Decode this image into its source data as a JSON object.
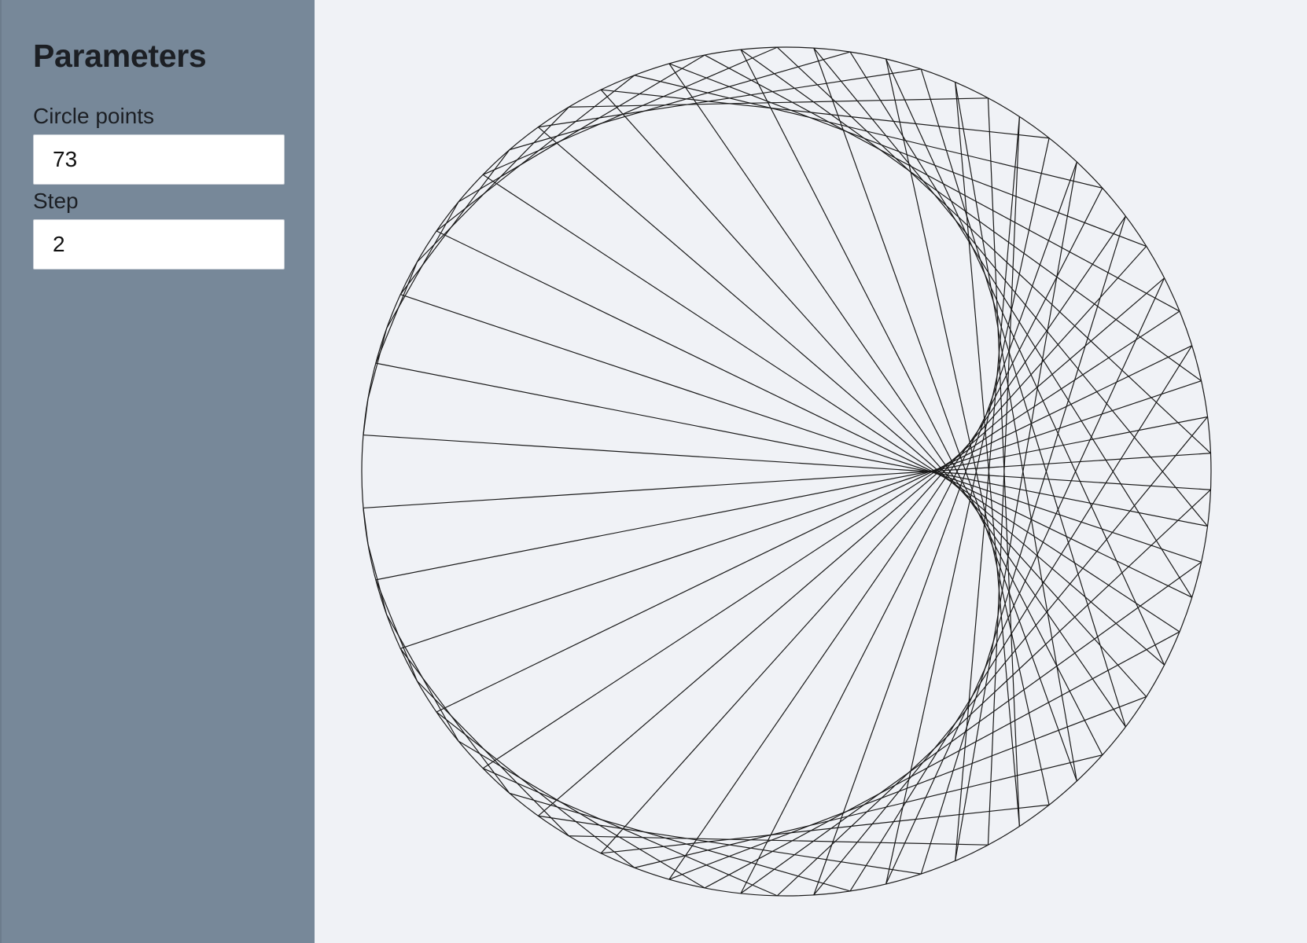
{
  "sidebar": {
    "title": "Parameters",
    "fields": [
      {
        "label": "Circle points",
        "value": "73"
      },
      {
        "label": "Step",
        "value": "2"
      }
    ]
  },
  "drawing": {
    "type": "modular-multiplication-circle",
    "points": 73,
    "multiplier": 2,
    "line_color": "#1a1a1a",
    "background": "#f0f2f6"
  },
  "colors": {
    "sidebar_background": "#778899",
    "canvas_background": "#f0f2f6",
    "input_background": "#ffffff",
    "text": "#1c1f24"
  }
}
